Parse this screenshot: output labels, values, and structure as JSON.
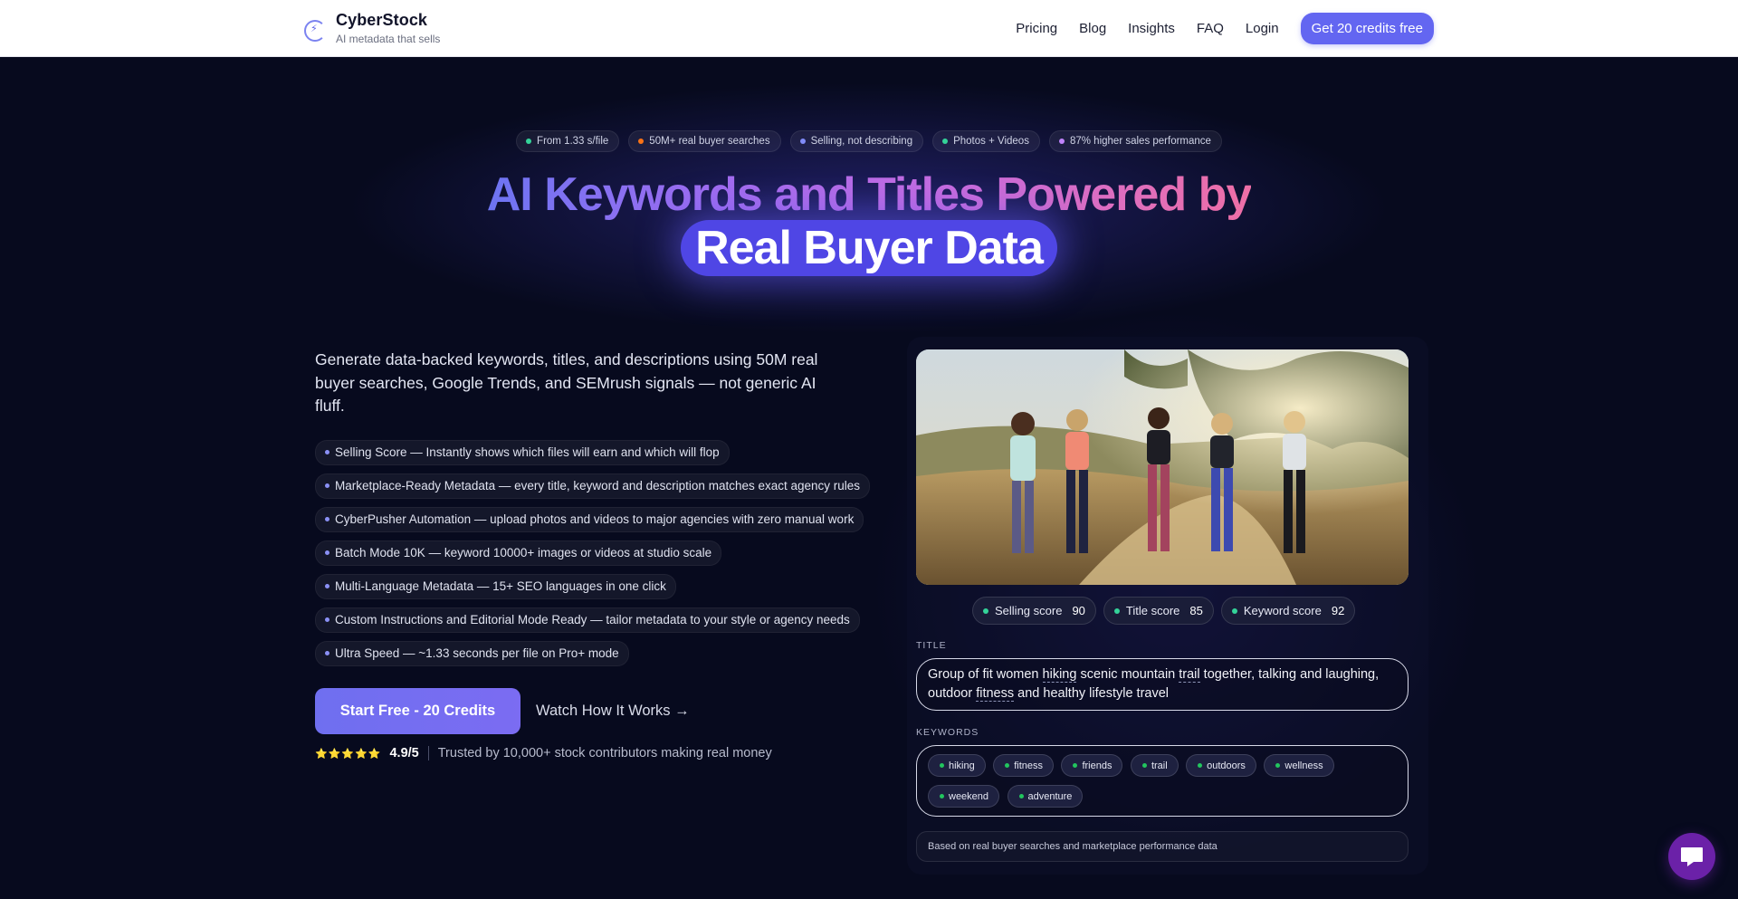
{
  "brand": {
    "name": "CyberStock",
    "tagline": "AI metadata that sells",
    "logo_icon": "lightning-bolt-icon"
  },
  "nav": {
    "links": [
      "Pricing",
      "Blog",
      "Insights",
      "FAQ",
      "Login"
    ],
    "cta": "Get 20 credits free"
  },
  "chips": [
    {
      "label": "From 1.33 s/file",
      "color": "#34d399"
    },
    {
      "label": "50M+ real buyer searches",
      "color": "#f97316"
    },
    {
      "label": "Selling, not describing",
      "color": "#818cf8"
    },
    {
      "label": "Photos + Videos",
      "color": "#34d399"
    },
    {
      "label": "87% higher sales performance",
      "color": "#c084fc"
    }
  ],
  "hero": {
    "headline_line1": "AI Keywords and Titles Powered by",
    "headline_highlight": "Real Buyer Data",
    "intro": "Generate data-backed keywords, titles, and descriptions using 50M real buyer searches, Google Trends, and SEMrush signals — not generic AI fluff."
  },
  "features": [
    "Selling Score — Instantly shows which files will earn and which will flop",
    "Marketplace-Ready Metadata — every title, keyword and description matches exact agency rules",
    "CyberPusher Automation — upload photos and videos to major agencies with zero manual work",
    "Batch Mode 10K — keyword 10000+ images or videos at studio scale",
    "Multi-Language Metadata — 15+ SEO languages in one click",
    "Custom Instructions and Editorial Mode Ready — tailor metadata to your style or agency needs",
    "Ultra Speed — ~1.33 seconds per file on Pro+ mode"
  ],
  "cta": {
    "primary": "Start Free - 20 Credits",
    "secondary": "Watch How It Works →"
  },
  "rating": {
    "stars": "⭐⭐⭐⭐⭐",
    "score": "4.9/5",
    "text": "Trusted by 10,000+ stock contributors making real money"
  },
  "demo": {
    "scores": [
      {
        "label": "Selling score",
        "value": "90"
      },
      {
        "label": "Title score",
        "value": "85"
      },
      {
        "label": "Keyword score",
        "value": "92"
      }
    ],
    "title_label": "TITLE",
    "title_parts": [
      "Group of fit women ",
      "hiking",
      " scenic mountain ",
      "trail",
      " together, talking and laughing, outdoor ",
      "fitness",
      " and healthy lifestyle travel"
    ],
    "keywords_label": "KEYWORDS",
    "keywords": [
      "hiking",
      "fitness",
      "friends",
      "trail",
      "outdoors",
      "wellness",
      "weekend",
      "adventure"
    ],
    "footnote": "Based on real buyer searches and marketplace performance data",
    "score_dot_color": "#34d399"
  },
  "chat": {
    "icon": "chat-bubble-icon"
  }
}
